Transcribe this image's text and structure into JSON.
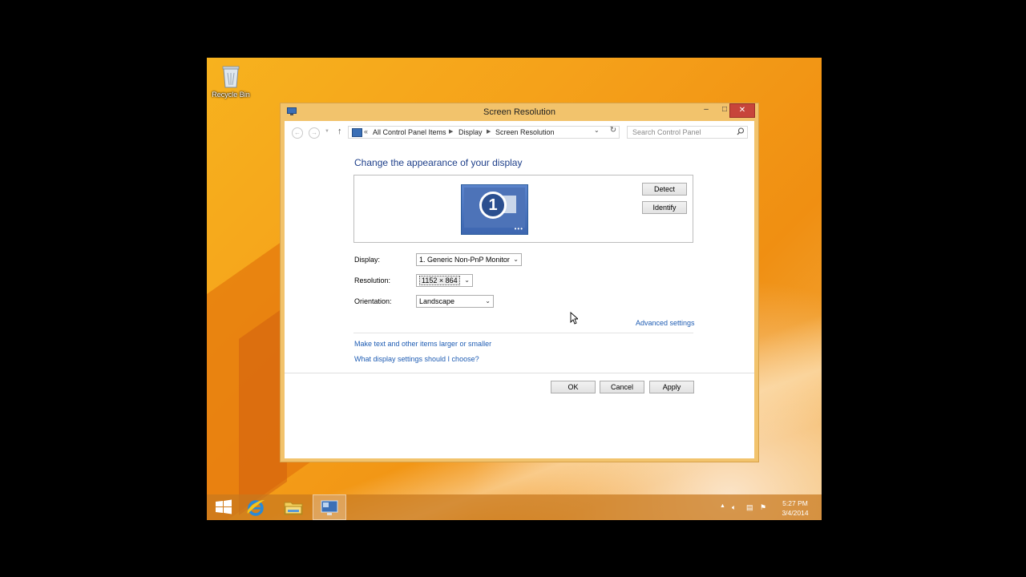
{
  "desktop": {
    "icons": [
      {
        "label": "Recycle Bin",
        "icon": "recycle-bin-icon"
      }
    ]
  },
  "window": {
    "title": "Screen Resolution",
    "controls": {
      "minimize": "–",
      "maximize": "□",
      "close": "✕"
    }
  },
  "address_bar": {
    "breadcrumbs": [
      "All Control Panel Items",
      "Display",
      "Screen Resolution"
    ],
    "overflow": "«",
    "search_placeholder": "Search Control Panel"
  },
  "main": {
    "heading": "Change the appearance of your display",
    "monitor_number": "1",
    "detect_label": "Detect",
    "identify_label": "Identify",
    "display_label": "Display:",
    "display_value": "1. Generic Non-PnP Monitor",
    "resolution_label": "Resolution:",
    "resolution_value": "1152 × 864",
    "orientation_label": "Orientation:",
    "orientation_value": "Landscape",
    "advanced_settings": "Advanced settings",
    "link_text_size": "Make text and other items larger or smaller",
    "link_settings_help": "What display settings should I choose?",
    "ok_label": "OK",
    "cancel_label": "Cancel",
    "apply_label": "Apply"
  },
  "taskbar": {
    "pinned": [
      "start-icon",
      "internet-explorer-icon",
      "file-explorer-icon",
      "display-settings-icon"
    ],
    "clock_time": "5:27 PM",
    "clock_date": "3/4/2014"
  },
  "colors": {
    "accent_link": "#1e5cb3",
    "heading": "#1e3f8a",
    "window_frame": "#f2c36c",
    "close_button": "#c7453b"
  }
}
